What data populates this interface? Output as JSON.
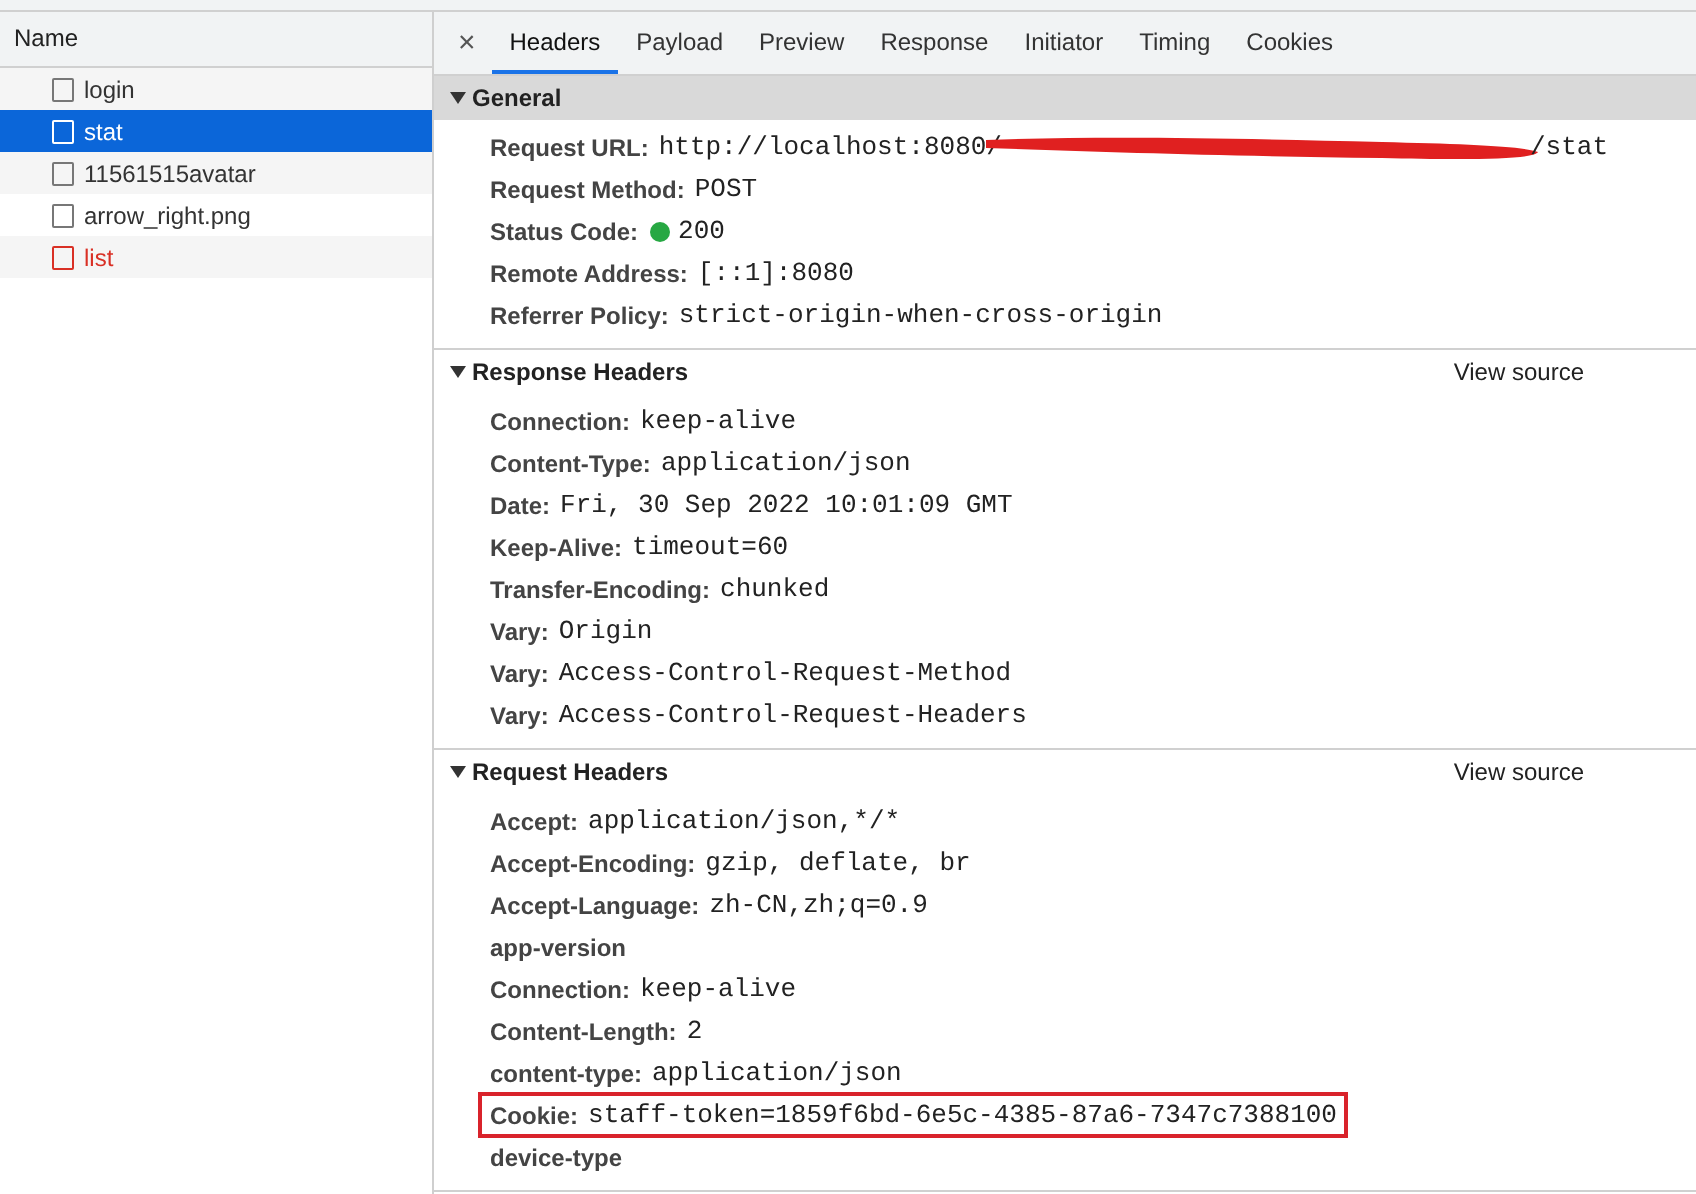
{
  "requests": {
    "column": "Name",
    "items": [
      {
        "name": "login",
        "selected": false,
        "failed": false
      },
      {
        "name": "stat",
        "selected": true,
        "failed": false
      },
      {
        "name": "11561515avatar",
        "selected": false,
        "failed": false
      },
      {
        "name": "arrow_right.png",
        "selected": false,
        "failed": false
      },
      {
        "name": "list",
        "selected": false,
        "failed": true
      }
    ]
  },
  "close": "×",
  "tabs": [
    {
      "label": "Headers",
      "selected": true
    },
    {
      "label": "Payload",
      "selected": false
    },
    {
      "label": "Preview",
      "selected": false
    },
    {
      "label": "Response",
      "selected": false
    },
    {
      "label": "Initiator",
      "selected": false
    },
    {
      "label": "Timing",
      "selected": false
    },
    {
      "label": "Cookies",
      "selected": false
    }
  ],
  "sections": [
    {
      "title": "General",
      "expanded": true,
      "shaded": true,
      "rows": [
        {
          "kind": "redacted",
          "label": "Request URL:",
          "value": "http://localhost:8080/",
          "suffix": "/stat"
        },
        {
          "kind": "plain",
          "label": "Request Method:",
          "value": "POST"
        },
        {
          "kind": "status",
          "label": "Status Code:",
          "value": "200",
          "ok": true
        },
        {
          "kind": "plain",
          "label": "Remote Address:",
          "value": "[::1]:8080"
        },
        {
          "kind": "plain",
          "label": "Referrer Policy:",
          "value": "strict-origin-when-cross-origin"
        }
      ]
    },
    {
      "title": "Response Headers",
      "expanded": true,
      "shaded": false,
      "view_source": "View source",
      "rows": [
        {
          "kind": "plain",
          "label": "Connection:",
          "value": "keep-alive"
        },
        {
          "kind": "plain",
          "label": "Content-Type:",
          "value": "application/json"
        },
        {
          "kind": "plain",
          "label": "Date:",
          "value": "Fri, 30 Sep 2022 10:01:09 GMT"
        },
        {
          "kind": "plain",
          "label": "Keep-Alive:",
          "value": "timeout=60"
        },
        {
          "kind": "plain",
          "label": "Transfer-Encoding:",
          "value": "chunked"
        },
        {
          "kind": "plain",
          "label": "Vary:",
          "value": "Origin"
        },
        {
          "kind": "plain",
          "label": "Vary:",
          "value": "Access-Control-Request-Method"
        },
        {
          "kind": "plain",
          "label": "Vary:",
          "value": "Access-Control-Request-Headers"
        }
      ]
    },
    {
      "title": "Request Headers",
      "expanded": true,
      "shaded": false,
      "view_source": "View source",
      "rows": [
        {
          "kind": "plain",
          "label": "Accept:",
          "value": "application/json,*/*"
        },
        {
          "kind": "plain",
          "label": "Accept-Encoding:",
          "value": "gzip, deflate, br"
        },
        {
          "kind": "plain",
          "label": "Accept-Language:",
          "value": "zh-CN,zh;q=0.9"
        },
        {
          "kind": "plain",
          "label": "app-version"
        },
        {
          "kind": "plain",
          "label": "Connection:",
          "value": "keep-alive"
        },
        {
          "kind": "plain",
          "label": "Content-Length:",
          "value": "2"
        },
        {
          "kind": "plain",
          "label": "content-type:",
          "value": "application/json"
        },
        {
          "kind": "plain",
          "label": "Cookie:",
          "value": "staff-token=1859f6bd-6e5c-4385-87a6-7347c7388100",
          "highlighted": true
        },
        {
          "kind": "plain",
          "label": "device-type"
        }
      ]
    }
  ]
}
